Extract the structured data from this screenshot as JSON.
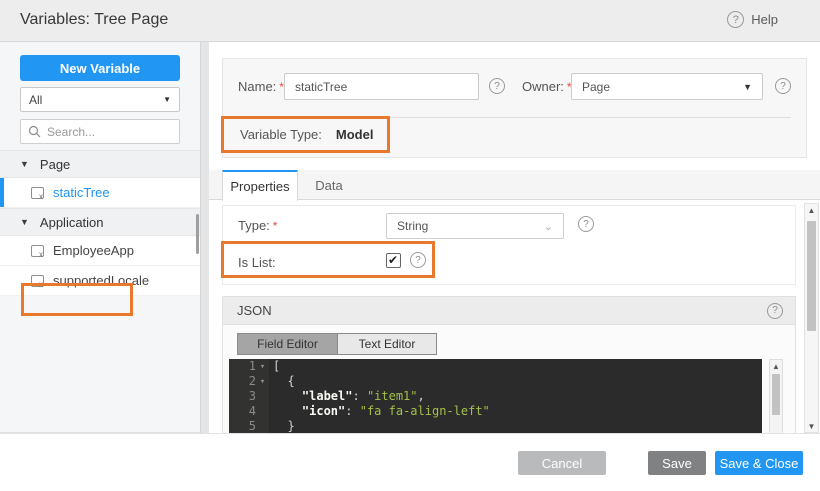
{
  "window": {
    "title": "Variables: Tree Page",
    "help_label": "Help"
  },
  "sidebar": {
    "new_variable_button": "New Variable",
    "filter_selected": "All",
    "search_placeholder": "Search...",
    "groups": [
      {
        "label": "Page",
        "items": [
          {
            "label": "staticTree",
            "selected": true,
            "highlighted": true
          }
        ]
      },
      {
        "label": "Application",
        "items": [
          {
            "label": "EmployeeApp"
          },
          {
            "label": "supportedLocale"
          }
        ]
      }
    ]
  },
  "form": {
    "name_label": "Name:",
    "required_mark": "*",
    "name_value": "staticTree",
    "owner_label": "Owner:",
    "owner_value": "Page",
    "variable_type_label": "Variable Type:",
    "variable_type_value": "Model"
  },
  "tabs": {
    "properties": "Properties",
    "data": "Data"
  },
  "properties_panel": {
    "type_label": "Type:",
    "type_value": "String",
    "is_list_label": "Is List:",
    "is_list_checked": true
  },
  "json_editor": {
    "title": "JSON",
    "field_editor_button": "Field Editor",
    "text_editor_button": "Text Editor",
    "lines": [
      {
        "num": "1",
        "plain": "["
      },
      {
        "num": "2",
        "plain": "  {"
      },
      {
        "num": "3",
        "indent": "    ",
        "key": "\"label\"",
        "sep": ": ",
        "value": "\"item1\"",
        "tail": ","
      },
      {
        "num": "4",
        "indent": "    ",
        "key": "\"icon\"",
        "sep": ": ",
        "value": "\"fa fa-align-left\"",
        "tail": ""
      },
      {
        "num": "5",
        "plain": "  }"
      }
    ]
  },
  "footer": {
    "cancel_button": "Cancel",
    "save_button": "Save",
    "save_close_button": "Save & Close"
  },
  "colors": {
    "accent_blue": "#2196f3",
    "highlight_orange": "#e8792c",
    "editor_string_green": "#a3c14a"
  }
}
